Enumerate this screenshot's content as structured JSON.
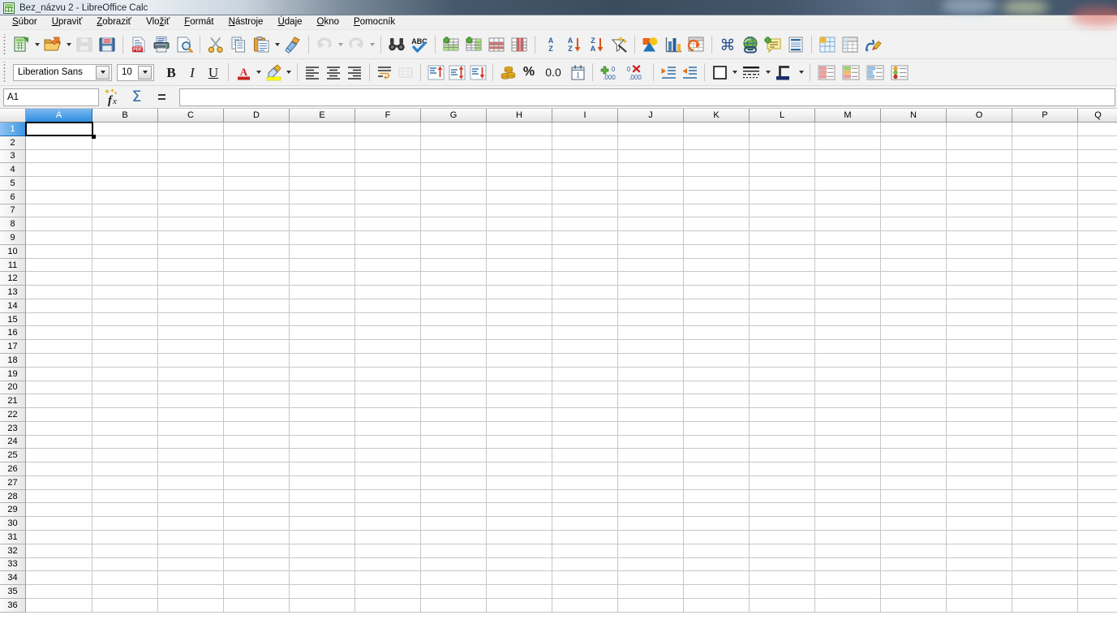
{
  "window": {
    "title": "Bez_názvu 2 - LibreOffice Calc",
    "app_icon": "calc-document-icon"
  },
  "menubar": {
    "items": [
      {
        "label": "Súbor",
        "accel": "S"
      },
      {
        "label": "Upraviť",
        "accel": "U"
      },
      {
        "label": "Zobraziť",
        "accel": "Z"
      },
      {
        "label": "Vložiť",
        "accel": "ž"
      },
      {
        "label": "Formát",
        "accel": "F"
      },
      {
        "label": "Nástroje",
        "accel": "N"
      },
      {
        "label": "Údaje",
        "accel": "Ú"
      },
      {
        "label": "Okno",
        "accel": "O"
      },
      {
        "label": "Pomocník",
        "accel": "P"
      }
    ]
  },
  "standard_toolbar": {
    "buttons": [
      {
        "name": "new-document",
        "label": "Nový",
        "has_dropdown": true,
        "enabled": true
      },
      {
        "name": "open-document",
        "label": "Otvoriť",
        "has_dropdown": true,
        "enabled": true
      },
      {
        "name": "save-document",
        "label": "Uložiť",
        "enabled": false
      },
      {
        "name": "save-as",
        "label": "Uložiť ako",
        "enabled": true
      },
      {
        "name": "export-pdf",
        "label": "Exportovať priamo ako PDF",
        "enabled": true
      },
      {
        "name": "print",
        "label": "Tlačiť",
        "enabled": true
      },
      {
        "name": "print-preview",
        "label": "Náhľad tlače",
        "enabled": true
      },
      {
        "name": "cut",
        "label": "Vystrihnúť",
        "enabled": true
      },
      {
        "name": "copy",
        "label": "Kopírovať",
        "enabled": true
      },
      {
        "name": "paste",
        "label": "Vložiť",
        "has_dropdown": true,
        "enabled": true
      },
      {
        "name": "clone-formatting",
        "label": "Klonovať formátovanie",
        "enabled": true
      },
      {
        "name": "undo",
        "label": "Späť",
        "has_dropdown": true,
        "enabled": false
      },
      {
        "name": "redo",
        "label": "Znova",
        "has_dropdown": true,
        "enabled": false
      },
      {
        "name": "find-replace",
        "label": "Nájsť a nahradiť",
        "enabled": true
      },
      {
        "name": "spelling",
        "label": "Kontrola pravopisu",
        "enabled": true
      },
      {
        "name": "insert-row",
        "label": "Vložiť riadok",
        "enabled": true
      },
      {
        "name": "insert-column",
        "label": "Vložiť stĺpec",
        "enabled": true
      },
      {
        "name": "delete-row",
        "label": "Odstrániť riadok",
        "enabled": true
      },
      {
        "name": "delete-column",
        "label": "Odstrániť stĺpec",
        "enabled": true
      },
      {
        "name": "sort",
        "label": "Zoradiť",
        "enabled": true
      },
      {
        "name": "sort-ascending",
        "label": "Zoradiť vzostupne",
        "enabled": true
      },
      {
        "name": "sort-descending",
        "label": "Zoradiť zostupne",
        "enabled": true
      },
      {
        "name": "autofilter",
        "label": "Automatický filter",
        "enabled": true
      },
      {
        "name": "insert-image",
        "label": "Vložiť obrázok",
        "enabled": true
      },
      {
        "name": "insert-chart",
        "label": "Vložiť graf",
        "enabled": true
      },
      {
        "name": "pivot-table",
        "label": "Kontingenčná tabuľka",
        "enabled": true
      },
      {
        "name": "special-character",
        "label": "Špeciálny znak",
        "enabled": true
      },
      {
        "name": "hyperlink",
        "label": "Hypertextový odkaz",
        "enabled": true
      },
      {
        "name": "insert-comment",
        "label": "Vložiť komentár",
        "enabled": true
      },
      {
        "name": "headers-footers",
        "label": "Hlavičky a päty",
        "enabled": true
      },
      {
        "name": "freeze-rows-columns",
        "label": "Ukotviť riadky a stĺpce",
        "enabled": true
      },
      {
        "name": "split-window",
        "label": "Rozdeliť okno",
        "enabled": true
      },
      {
        "name": "show-draw-functions",
        "label": "Zobraziť kresliace funkcie",
        "enabled": true
      }
    ]
  },
  "formatting_toolbar": {
    "font_name": "Liberation Sans",
    "font_size": "10",
    "bold": "B",
    "italic": "I",
    "underline": "U",
    "buttons": [
      {
        "name": "font-color",
        "label": "Farba písma",
        "color": "#c9211e",
        "has_dropdown": true
      },
      {
        "name": "highlighting-color",
        "label": "Farba zvýraznenia",
        "color": "#ffff00",
        "has_dropdown": true
      },
      {
        "name": "align-left",
        "label": "Zarovnať vľavo"
      },
      {
        "name": "align-center",
        "label": "Zarovnať na stred"
      },
      {
        "name": "align-right",
        "label": "Zarovnať vpravo"
      },
      {
        "name": "wrap-text",
        "label": "Zalomiť text"
      },
      {
        "name": "merge-cells",
        "label": "Zlúčiť bunky",
        "enabled": false
      },
      {
        "name": "align-top",
        "label": "Zarovnať hore"
      },
      {
        "name": "align-center-vertically",
        "label": "Zarovnať na stred zvisle"
      },
      {
        "name": "align-bottom",
        "label": "Zarovnať dole"
      },
      {
        "name": "format-as-currency",
        "label": "Formát ako mena"
      },
      {
        "name": "format-as-percent",
        "label": "Formát ako percento",
        "glyph": "%"
      },
      {
        "name": "format-as-number",
        "label": "Formát ako číslo",
        "glyph": "0.0"
      },
      {
        "name": "format-as-date",
        "label": "Formát ako dátum"
      },
      {
        "name": "add-decimal-place",
        "label": "Pridať desatinné miesto"
      },
      {
        "name": "delete-decimal-place",
        "label": "Odstrániť desatinné miesto"
      },
      {
        "name": "increase-indent",
        "label": "Zväčšiť odsadenie"
      },
      {
        "name": "decrease-indent",
        "label": "Zmenšiť odsadenie"
      },
      {
        "name": "borders",
        "label": "Orámovanie",
        "has_dropdown": true
      },
      {
        "name": "border-style",
        "label": "Štýl orámovania",
        "has_dropdown": true
      },
      {
        "name": "border-color",
        "label": "Farba orámovania",
        "color": "#1a2e6b",
        "has_dropdown": true
      },
      {
        "name": "conditional-formatting",
        "label": "Podmienené formátovanie"
      },
      {
        "name": "cell-styles-green",
        "label": "Štýly buniek"
      },
      {
        "name": "cell-styles-blue",
        "label": "Štýly buniek"
      },
      {
        "name": "cell-styles-traffic",
        "label": "Štýly buniek"
      }
    ]
  },
  "formula_bar": {
    "name_box_value": "A1",
    "name_box_name": "name-box",
    "function_wizard": "fx",
    "sum": "Σ",
    "formula": "=",
    "input_value": "",
    "input_placeholder": ""
  },
  "sheet": {
    "columns": [
      {
        "label": "A",
        "width": 82
      },
      {
        "label": "B",
        "width": 81
      },
      {
        "label": "C",
        "width": 81
      },
      {
        "label": "D",
        "width": 81
      },
      {
        "label": "E",
        "width": 81
      },
      {
        "label": "F",
        "width": 81
      },
      {
        "label": "G",
        "width": 81
      },
      {
        "label": "H",
        "width": 81
      },
      {
        "label": "I",
        "width": 81
      },
      {
        "label": "J",
        "width": 81
      },
      {
        "label": "K",
        "width": 81
      },
      {
        "label": "L",
        "width": 81
      },
      {
        "label": "M",
        "width": 81
      },
      {
        "label": "N",
        "width": 81
      },
      {
        "label": "O",
        "width": 81
      },
      {
        "label": "P",
        "width": 81
      },
      {
        "label": "Q",
        "width": 50
      }
    ],
    "rows": [
      "1",
      "2",
      "3",
      "4",
      "5",
      "6",
      "7",
      "8",
      "9",
      "10",
      "11",
      "12",
      "13",
      "14",
      "15",
      "16",
      "17",
      "18",
      "19",
      "20",
      "21",
      "22",
      "23",
      "24",
      "25",
      "26",
      "27",
      "28",
      "29",
      "30",
      "31",
      "32",
      "33",
      "34",
      "35",
      "36"
    ],
    "row_height": 16.77,
    "active_cell": "A1",
    "active_column_index": 0,
    "active_row_index": 0,
    "cell_values": {},
    "colors": {
      "header_active": "#2f8ee0",
      "gridline": "#c7c7c7",
      "selection_border": "#000000"
    }
  }
}
